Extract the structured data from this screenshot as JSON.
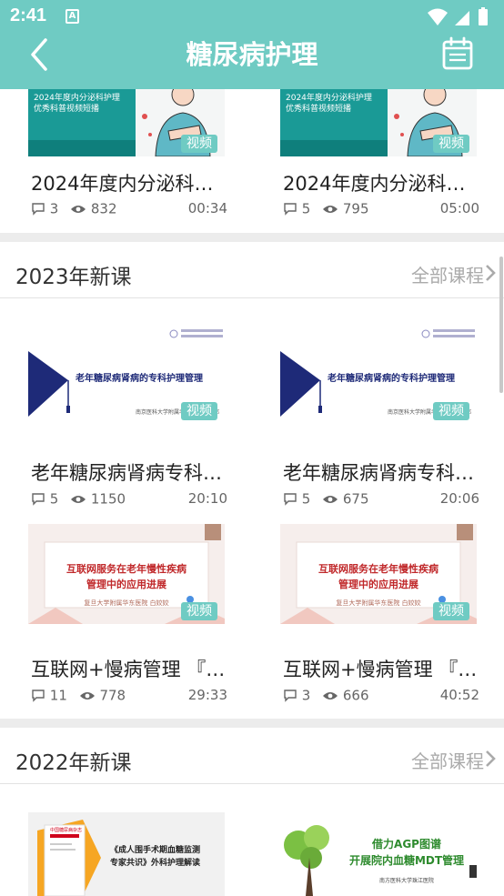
{
  "status": {
    "time": "2:41",
    "a_icon": "A"
  },
  "header": {
    "title": "糖尿病护理",
    "back_icon": "chevron-left-icon",
    "calendar_icon": "calendar-icon"
  },
  "badge_label": "视频",
  "top_courses": [
    {
      "thumb_line1": "2024年度内分泌科护理",
      "thumb_line2": "优秀科普视频短播",
      "title": "2024年度内分泌科…",
      "comments": "3",
      "views": "832",
      "duration": "00:34"
    },
    {
      "thumb_line1": "2024年度内分泌科护理",
      "thumb_line2": "优秀科普视频短播",
      "title": "2024年度内分泌科…",
      "comments": "5",
      "views": "795",
      "duration": "05:00"
    }
  ],
  "sections": [
    {
      "title": "2023年新课",
      "all_label": "全部课程",
      "courses": [
        {
          "thumb_title": "老年糖尿病肾病的专科护理管理",
          "thumb_sub": "南京医科大学附属老年医院  夏永都",
          "title": "老年糖尿病肾病专科…",
          "comments": "5",
          "views": "1150",
          "duration": "20:10"
        },
        {
          "thumb_title": "老年糖尿病肾病的专科护理管理",
          "thumb_sub": "南京医科大学附属老年医院  夏永都",
          "title": "老年糖尿病肾病专科…",
          "comments": "5",
          "views": "675",
          "duration": "20:06"
        },
        {
          "thumb_title": "互联网服务在老年慢性疾病",
          "thumb_title2": "管理中的应用进展",
          "thumb_sub": "复旦大学附属华东医院  白姣姣",
          "title": "互联网+慢病管理 『…",
          "comments": "11",
          "views": "778",
          "duration": "29:33"
        },
        {
          "thumb_title": "互联网服务在老年慢性疾病",
          "thumb_title2": "管理中的应用进展",
          "thumb_sub": "复旦大学附属华东医院  白姣姣",
          "title": "互联网+慢病管理 『…",
          "comments": "3",
          "views": "666",
          "duration": "40:52"
        }
      ]
    },
    {
      "title": "2022年新课",
      "all_label": "全部课程",
      "courses": [
        {
          "thumb_title": "《成人围手术期血糖监测",
          "thumb_title2": "专家共识》外科护理解读",
          "thumb_sub": "中国糖尿病杂志"
        },
        {
          "thumb_title": "借力AGP图谱",
          "thumb_title2": "开展院内血糖MDT管理",
          "thumb_sub": "南方医科大学珠江医院"
        }
      ]
    }
  ],
  "colors": {
    "accent": "#6fcbc3",
    "red_title": "#c0282a",
    "navy": "#1e2a78",
    "green_title": "#2e8b2e"
  }
}
